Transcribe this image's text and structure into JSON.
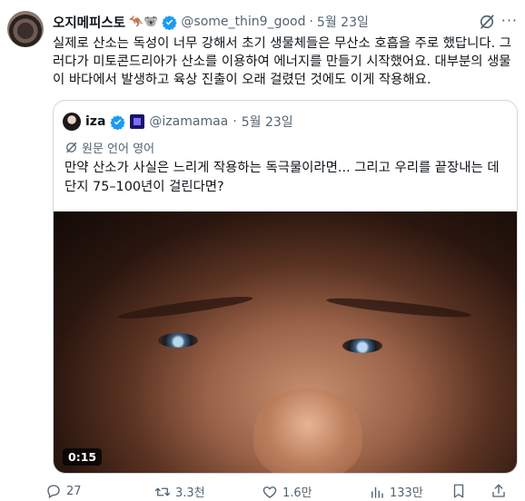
{
  "tweet": {
    "author_name": "오지메피스토",
    "author_emoji": "🦘🐨",
    "handle": "@some_thin9_good",
    "separator": "·",
    "date": "5월 23일",
    "text": "실제로 산소는 독성이 너무 강해서 초기 생물체들은 무산소 호흡을 주로 했답니다. 그러다가 미토콘드리아가 산소를 이용하여 에너지를 만들기 시작했어요. 대부분의 생물이 바다에서 발생하고 육상 진출이 오래 걸렸던 것에도 이게 작용해요."
  },
  "quote": {
    "author_name": "iza",
    "handle": "@izamamaa",
    "separator": "·",
    "date": "5월 23일",
    "translate_label": "원문 언어 영어",
    "text": "만약 산소가 사실은 느리게 작용하는 독극물이라면... 그리고 우리를 끝장내는 데 단지 75–100년이 걸린다면?",
    "video_time": "0:15"
  },
  "actions": {
    "replies": "27",
    "retweets": "3.3천",
    "likes": "1.6만",
    "views": "133만"
  },
  "colors": {
    "verified": "#1d9bf0",
    "muted_text": "#536471",
    "border": "#cfd9de"
  },
  "icons": [
    "grok-icon",
    "more-icon",
    "verified-icon",
    "translate-icon",
    "reply-icon",
    "retweet-icon",
    "like-icon",
    "views-icon",
    "bookmark-icon",
    "share-icon"
  ]
}
